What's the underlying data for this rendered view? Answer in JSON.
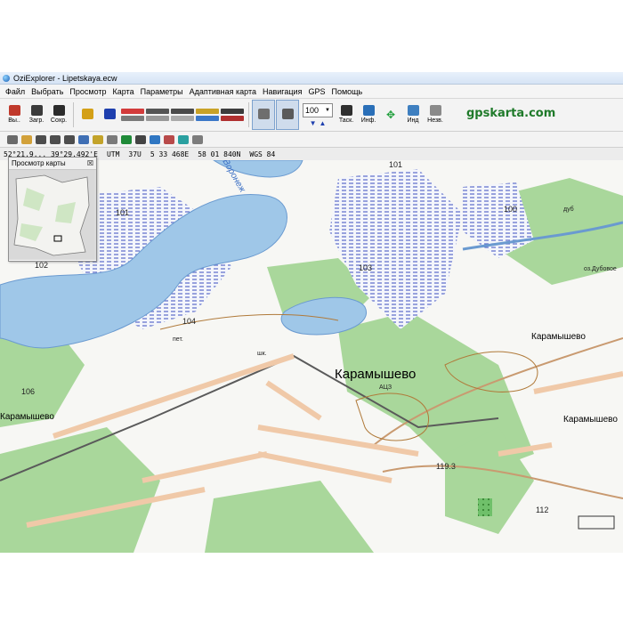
{
  "window": {
    "title": "OziExplorer - Lipetskaya.ecw"
  },
  "menu": [
    "Файл",
    "Выбрать",
    "Просмотр",
    "Карта",
    "Параметры",
    "Адаптивная карта",
    "Навигация",
    "GPS",
    "Помощь"
  ],
  "toolbar": {
    "exit_label": "Вы..",
    "load_label": "Загр.",
    "save_label": "Сохр.",
    "zoom_value": "100",
    "track_label": "Таск.",
    "info_label": "Инф.",
    "ind_label": "Инд",
    "hide_label": "Незв."
  },
  "brand": "gpskarta.com",
  "status": {
    "coords": "52°21,9... 39°29,492'E",
    "utm_label": "UTM",
    "utm_zone": "37U",
    "easting": "5 33 468E",
    "northing": "58 01 840N",
    "datum": "WGS 84"
  },
  "overview": {
    "title": "Просмотр карты"
  },
  "map": {
    "river_label": "Воронеж",
    "town": "Карамышево",
    "town_code": "АЦЗ",
    "villages": [
      "Карамышево",
      "Карамышево",
      "Карамышево"
    ],
    "numbers": [
      "101",
      "101",
      "100",
      "102",
      "103",
      "104",
      "106",
      "112",
      "119.3"
    ],
    "small_labels": [
      "оз.Дубовое",
      "дуб",
      "пет.",
      "шк."
    ]
  }
}
